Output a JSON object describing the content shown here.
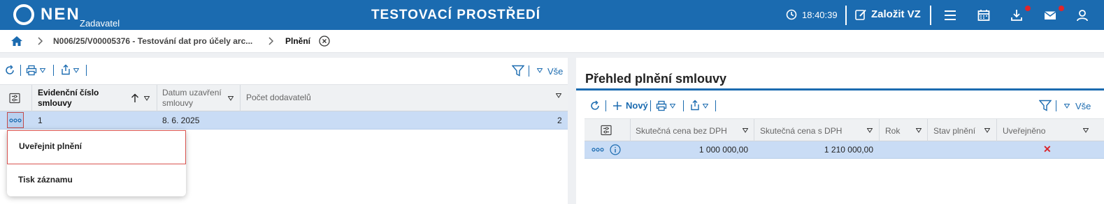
{
  "topbar": {
    "brand": "NEN",
    "role": "Zadavatel",
    "environment": "TESTOVACÍ PROSTŘEDÍ",
    "time": "18:40:39",
    "create_label": "Založit VZ",
    "color": "#1b6bb0",
    "notification_color": "#e0252b"
  },
  "breadcrumb": {
    "items": [
      "N006/25/V00005376 - Testování dat pro účely arc...",
      "Plnění"
    ]
  },
  "left": {
    "filter_all_label": "Vše",
    "columns": [
      "Evidenční číslo\nsmlouvy",
      "Datum uzavření\nsmlouvy",
      "Počet dodavatelů"
    ],
    "col1_line1": "Evidenční číslo",
    "col1_line2": "smlouvy",
    "col2_line1": "Datum uzavření",
    "col2_line2": "smlouvy",
    "col3": "Počet dodavatelů",
    "rows": [
      {
        "cislo": "1",
        "datum": "8. 6. 2025",
        "pocet": "2"
      }
    ],
    "context_menu": [
      "Uveřejnit plnění",
      "Tisk záznamu"
    ]
  },
  "right": {
    "title": "Přehled plnění smlouvy",
    "new_label": "Nový",
    "filter_all_label": "Vše",
    "columns": [
      "Skutečná cena bez DPH",
      "Skutečná cena s DPH",
      "Rok",
      "Stav plnění",
      "Uveřejněno"
    ],
    "rows": [
      {
        "bez_dph": "1 000 000,00",
        "s_dph": "1 210 000,00",
        "rok": "",
        "stav": "",
        "uverejneno": "✕"
      }
    ]
  }
}
